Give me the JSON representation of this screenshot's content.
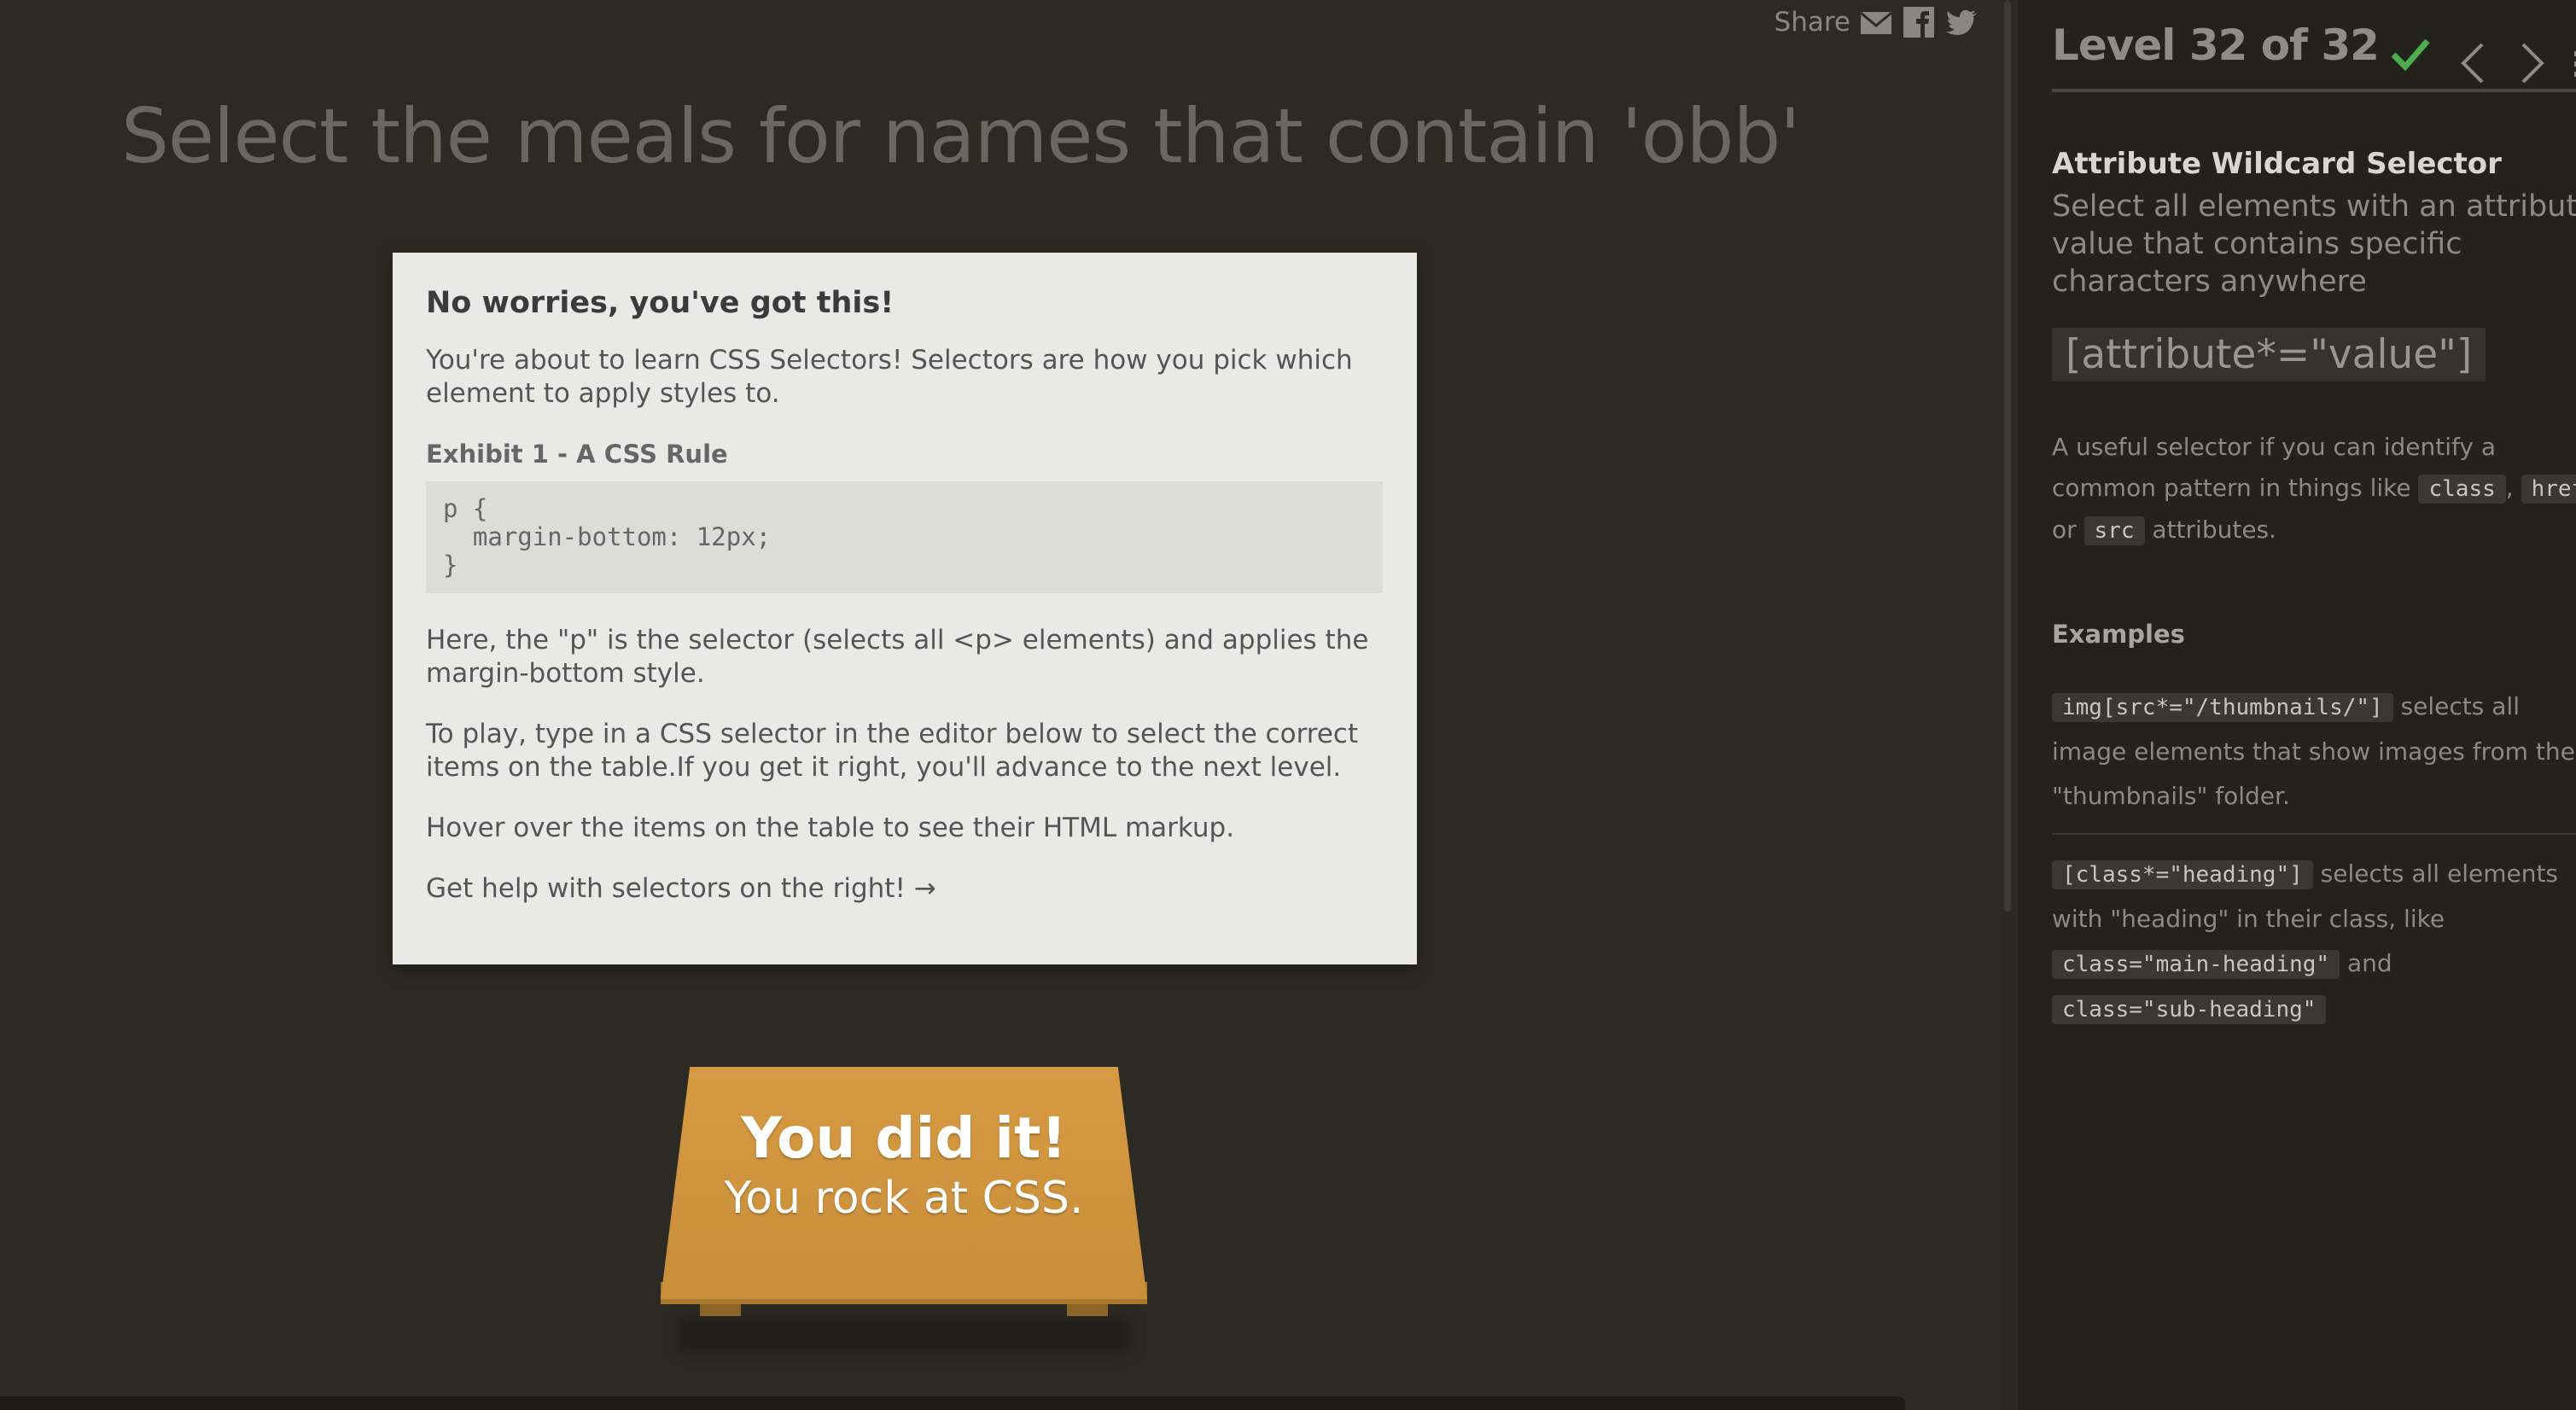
{
  "share": {
    "label": "Share",
    "icons": [
      "email-icon",
      "facebook-icon",
      "twitter-icon"
    ]
  },
  "order": "Select the meals for names that contain 'obb'",
  "help": {
    "title": "No worries, you've got this!",
    "intro": "You're about to learn CSS Selectors! Selectors are how you pick which element to apply styles to.",
    "exhibit_title": "Exhibit 1 - A CSS Rule",
    "code": "p {\n  margin-bottom: 12px;\n}",
    "explain": "Here, the \"p\" is the selector (selects all <p> elements) and applies the margin-bottom style.",
    "play": "To play, type in a CSS selector in the editor below to select the correct items on the table.If you get it right, you'll advance to the next level.",
    "hover": "Hover over the items on the table to see their HTML markup.",
    "help_right": "Get help with selectors on the right! →"
  },
  "table": {
    "big": "You did it!",
    "small": "You rock at CSS."
  },
  "sidebar": {
    "level": "Level 32 of 32",
    "completed": true,
    "selector_name": "Attribute Wildcard Selector",
    "title": "Select all elements with an attribute value that contains specific characters anywhere",
    "syntax": "[attribute*=\"value\"]",
    "hint": {
      "before": "A useful selector if you can identify a common pattern in things like ",
      "tag1": "class",
      "sep1": ", ",
      "tag2": "href",
      "sep2": " or ",
      "tag3": "src",
      "after": " attributes."
    },
    "examples_title": "Examples",
    "examples": [
      {
        "code": "img[src*=\"/thumbnails/\"]",
        "text": " selects all image elements that show images from the \"thumbnails\" folder."
      },
      {
        "code": "[class*=\"heading\"]",
        "text1": " selects all elements with \"heading\" in their class, like ",
        "tag_a": "class=\"main-heading\"",
        "text2": " and ",
        "tag_b": "class=\"sub-heading\""
      }
    ]
  },
  "colors": {
    "background": "#2d2a23",
    "accent": "#4cae4c",
    "table": "#d69a42"
  }
}
